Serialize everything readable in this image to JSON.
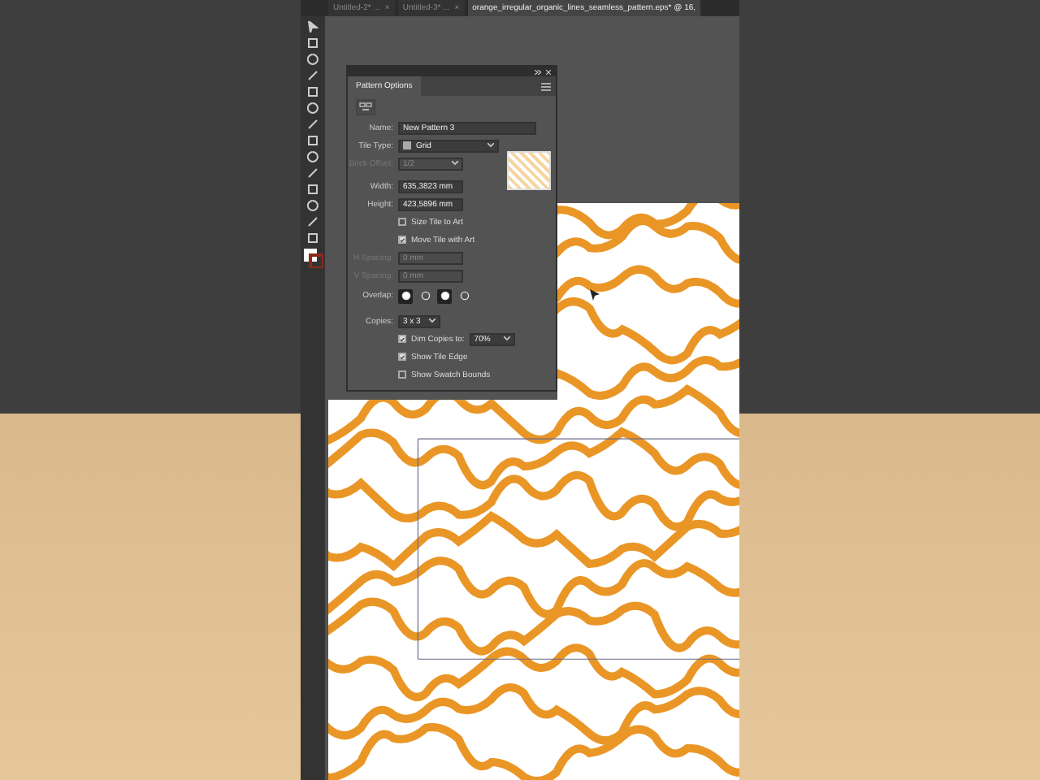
{
  "tabs": [
    {
      "label": "Untitled-2* ...",
      "close": "×",
      "selected": false
    },
    {
      "label": "Untitled-3* ...",
      "close": "×",
      "selected": false
    },
    {
      "label": "orange_irregular_organic_lines_seamless_pattern.eps* @ 16,",
      "selected": true
    }
  ],
  "panel": {
    "title": "Pattern Options",
    "name": {
      "label": "Name:",
      "value": "New Pattern 3"
    },
    "tile_type": {
      "label": "Tile Type:",
      "value": "Grid"
    },
    "brick_offset": {
      "label": "Brick Offset:",
      "value": "1/2",
      "disabled": true
    },
    "width": {
      "label": "Width:",
      "value": "635,3823 mm"
    },
    "height": {
      "label": "Height:",
      "value": "423,5896 mm"
    },
    "tile_checks": [
      {
        "label": "Size Tile to Art",
        "checked": false
      },
      {
        "label": "Move Tile with Art",
        "checked": true
      }
    ],
    "spacing": [
      {
        "label": "H Spacing:",
        "value": "0 mm",
        "disabled": true
      },
      {
        "label": "V Spacing:",
        "value": "0 mm",
        "disabled": true
      }
    ],
    "overlap": {
      "label": "Overlap:",
      "options": [
        {
          "selected": true
        },
        {
          "selected": false
        },
        {
          "selected": true
        },
        {
          "selected": false
        }
      ]
    },
    "copies": {
      "label": "Copies:",
      "value": "3 x 3"
    },
    "dim": {
      "label": "Dim Copies to:",
      "value": "70%",
      "checked": true
    },
    "show_checks": [
      {
        "label": "Show Tile Edge",
        "checked": true
      },
      {
        "label": "Show Swatch Bounds",
        "checked": false
      }
    ]
  }
}
